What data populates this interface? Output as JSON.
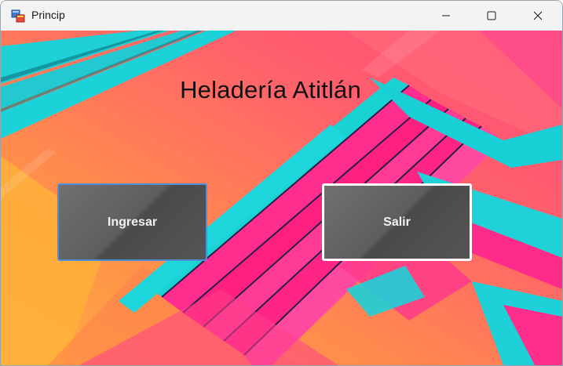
{
  "window": {
    "title": "Princip",
    "controls": {
      "minimize_icon": "minimize-icon",
      "maximize_icon": "maximize-icon",
      "close_icon": "close-icon"
    }
  },
  "form": {
    "heading": "Heladería Atitlán",
    "buttons": {
      "ingresar": "Ingresar",
      "salir": "Salir"
    }
  },
  "colors": {
    "background_orange": "#ff8a50",
    "background_pink": "#ff4f7b",
    "accent_cyan": "#19d3d3",
    "accent_magenta": "#ff2d8a",
    "button_gray": "#5a5a5a",
    "focus_border": "#4d8fd8"
  }
}
